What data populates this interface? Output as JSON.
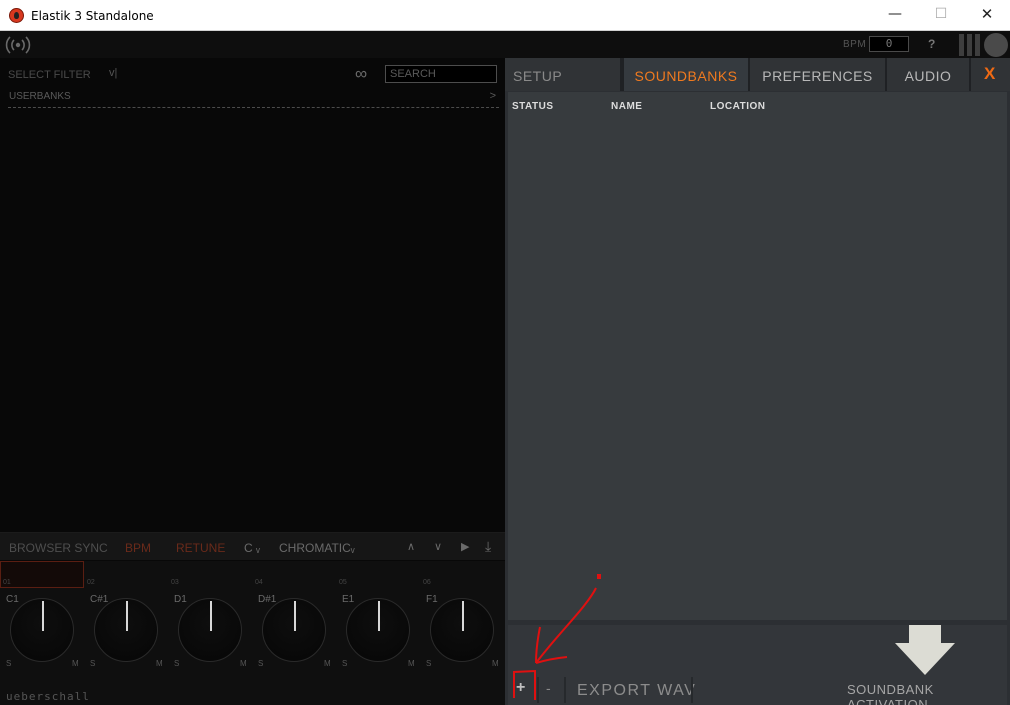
{
  "window": {
    "title": "Elastik 3 Standalone",
    "minimize": "—",
    "maximize": "☐",
    "close": "✕"
  },
  "topbar": {
    "bpm_label": "BPM",
    "bpm_value": "0",
    "help": "?"
  },
  "browser": {
    "select_filter": "SELECT FILTER",
    "filter_caret": "v|",
    "link_symbol": "∞",
    "search_placeholder": "SEARCH",
    "userbanks": "USERBANKS",
    "userbanks_arrow": ">"
  },
  "controls": {
    "browser_sync": "BROWSER SYNC",
    "bpm": "BPM",
    "retune": "RETUNE",
    "key": "C ᵥ",
    "scale": "CHROMATICᵥ",
    "up": "∧",
    "down": "∨",
    "play": "▶",
    "download": "⤓"
  },
  "knobs": [
    {
      "index": "01",
      "note": "C1",
      "s": "S",
      "m": "M"
    },
    {
      "index": "02",
      "note": "C#1",
      "s": "S",
      "m": "M"
    },
    {
      "index": "03",
      "note": "D1",
      "s": "S",
      "m": "M"
    },
    {
      "index": "04",
      "note": "D#1",
      "s": "S",
      "m": "M"
    },
    {
      "index": "05",
      "note": "E1",
      "s": "S",
      "m": "M"
    },
    {
      "index": "06",
      "note": "F1",
      "s": "S",
      "m": "M"
    }
  ],
  "brand": "ueberschall",
  "settings": {
    "tabs": {
      "setup": "SETUP",
      "soundbanks": "SOUNDBANKS",
      "preferences": "PREFERENCES",
      "audio": "AUDIO",
      "close": "X"
    },
    "active_tab": "soundbanks",
    "accent_color": "#f07a1f",
    "columns": {
      "status": "STATUS",
      "name": "NAME",
      "location": "LOCATION"
    },
    "add": "+",
    "remove": "-",
    "export_wav": "EXPORT WAV",
    "soundbank_activation": "SOUNDBANK ACTIVATION"
  },
  "annotation_color": "#e01010"
}
